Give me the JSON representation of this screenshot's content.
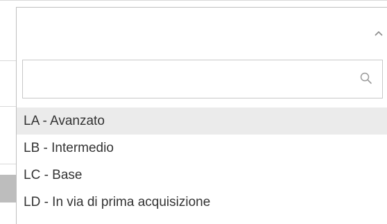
{
  "select": {
    "selected_value": "",
    "chevron_icon": "chevron-up-icon"
  },
  "search": {
    "value": "",
    "placeholder": "",
    "icon": "search-icon"
  },
  "options": [
    {
      "label": "LA - Avanzato",
      "highlighted": true
    },
    {
      "label": "LB - Intermedio",
      "highlighted": false
    },
    {
      "label": "LC - Base",
      "highlighted": false
    },
    {
      "label": "LD - In via di prima acquisizione",
      "highlighted": false
    }
  ],
  "colors": {
    "highlight": "#ebebeb",
    "text": "#333333",
    "border": "#bfbfbf"
  }
}
